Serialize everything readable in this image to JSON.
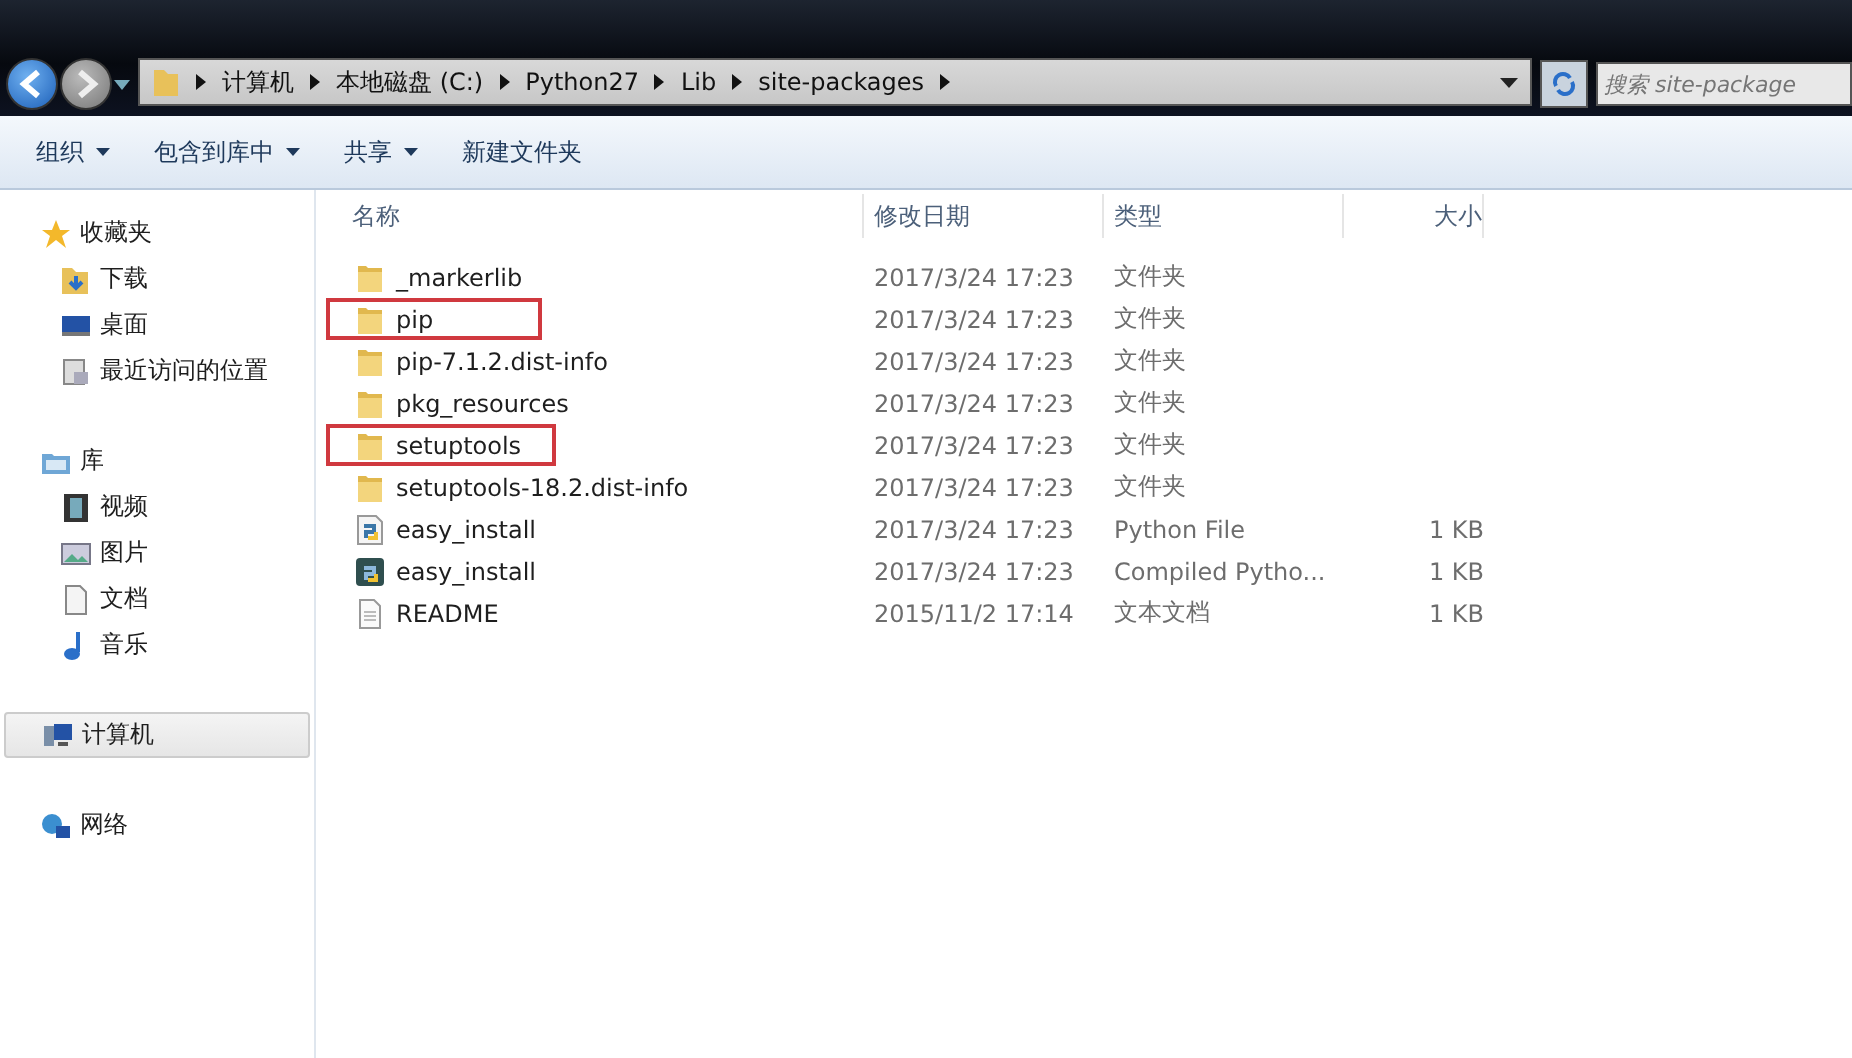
{
  "address_bar": {
    "segments": [
      "计算机",
      "本地磁盘 (C:)",
      "Python27",
      "Lib",
      "site-packages"
    ]
  },
  "search": {
    "placeholder": "搜索 site-package"
  },
  "toolbar": [
    {
      "label": "组织",
      "dropdown": true
    },
    {
      "label": "包含到库中",
      "dropdown": true
    },
    {
      "label": "共享",
      "dropdown": true
    },
    {
      "label": "新建文件夹",
      "dropdown": false
    }
  ],
  "sidebar": {
    "groups": [
      {
        "label": "收藏夹",
        "kind": "star",
        "selected": false,
        "children": [
          {
            "label": "下载",
            "kind": "download",
            "selected": false
          },
          {
            "label": "桌面",
            "kind": "desktop",
            "selected": false
          },
          {
            "label": "最近访问的位置",
            "kind": "recent",
            "selected": false
          }
        ]
      },
      {
        "label": "库",
        "kind": "library",
        "selected": false,
        "children": [
          {
            "label": "视频",
            "kind": "video",
            "selected": false
          },
          {
            "label": "图片",
            "kind": "picture",
            "selected": false
          },
          {
            "label": "文档",
            "kind": "document",
            "selected": false
          },
          {
            "label": "音乐",
            "kind": "music",
            "selected": false
          }
        ]
      },
      {
        "label": "计算机",
        "kind": "computer",
        "selected": true
      },
      {
        "label": "网络",
        "kind": "network",
        "selected": false
      }
    ]
  },
  "table": {
    "columns": [
      "名称",
      "修改日期",
      "类型",
      "大小"
    ],
    "rows": [
      {
        "kind": "folder",
        "name": "_markerlib",
        "date": "2017/3/24 17:23",
        "type": "文件夹",
        "size": "",
        "highlighted": false
      },
      {
        "kind": "folder",
        "name": "pip",
        "date": "2017/3/24 17:23",
        "type": "文件夹",
        "size": "",
        "highlighted": true
      },
      {
        "kind": "folder",
        "name": "pip-7.1.2.dist-info",
        "date": "2017/3/24 17:23",
        "type": "文件夹",
        "size": "",
        "highlighted": false
      },
      {
        "kind": "folder",
        "name": "pkg_resources",
        "date": "2017/3/24 17:23",
        "type": "文件夹",
        "size": "",
        "highlighted": false
      },
      {
        "kind": "folder",
        "name": "setuptools",
        "date": "2017/3/24 17:23",
        "type": "文件夹",
        "size": "",
        "highlighted": true
      },
      {
        "kind": "folder",
        "name": "setuptools-18.2.dist-info",
        "date": "2017/3/24 17:23",
        "type": "文件夹",
        "size": "",
        "highlighted": false
      },
      {
        "kind": "python",
        "name": "easy_install",
        "date": "2017/3/24 17:23",
        "type": "Python File",
        "size": "1 KB",
        "highlighted": false
      },
      {
        "kind": "compiled",
        "name": "easy_install",
        "date": "2017/3/24 17:23",
        "type": "Compiled Pytho...",
        "size": "1 KB",
        "highlighted": false
      },
      {
        "kind": "text",
        "name": "README",
        "date": "2015/11/2 17:14",
        "type": "文本文档",
        "size": "1 KB",
        "highlighted": false
      }
    ]
  }
}
